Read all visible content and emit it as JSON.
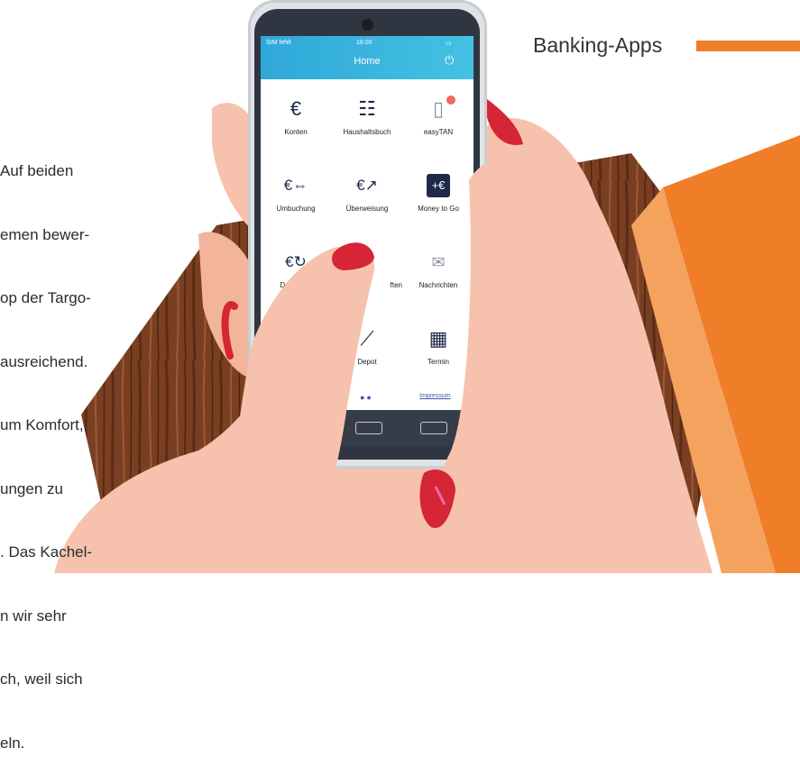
{
  "article": {
    "lines": [
      "Auf beiden",
      "emen bewer-",
      "op der Targo-",
      "ausreichend.",
      "um Komfort,",
      "ungen zu",
      ". Das Kachel-",
      "n wir sehr",
      "ch, weil sich",
      "eln."
    ]
  },
  "section": {
    "label": "Banking-Apps",
    "accent": "#f07d28"
  },
  "phone": {
    "status_carrier": "SIM fehlt",
    "status_time": "16:00",
    "title": "Home",
    "tiles": [
      {
        "label": "Konten",
        "icon": "euro-icon",
        "glyph": "€"
      },
      {
        "label": "Haushaltsbuch",
        "icon": "checklist-icon",
        "glyph": "☷"
      },
      {
        "label": "easyTAN",
        "icon": "tan-device-icon",
        "glyph": "▯"
      },
      {
        "label": "Umbuchung",
        "icon": "euro-transfer-icon",
        "glyph": "€⇔"
      },
      {
        "label": "Überweisung",
        "icon": "euro-send-icon",
        "glyph": "€↗"
      },
      {
        "label": "Money to Go",
        "icon": "money-to-go-icon",
        "glyph": "+€"
      },
      {
        "label": "Dauerauft",
        "icon": "euro-recurring-icon",
        "glyph": "€↻"
      },
      {
        "label": "ften",
        "icon": "hidden-tile-icon",
        "glyph": ""
      },
      {
        "label": "Nachrichten",
        "icon": "envelope-icon",
        "glyph": "✉"
      },
      {
        "label": "",
        "icon": "hidden-tile-icon",
        "glyph": ""
      },
      {
        "label": "Depot",
        "icon": "chart-icon",
        "glyph": "⟋"
      },
      {
        "label": "Termin",
        "icon": "calendar-icon",
        "glyph": "▦"
      }
    ],
    "impressum": "Impressum",
    "appbar_color": "#2fa8d8"
  },
  "colors": {
    "orange": "#f07d28",
    "wood": "#7a3f22",
    "skin": "#f6c2ad",
    "nail": "#d62535"
  }
}
